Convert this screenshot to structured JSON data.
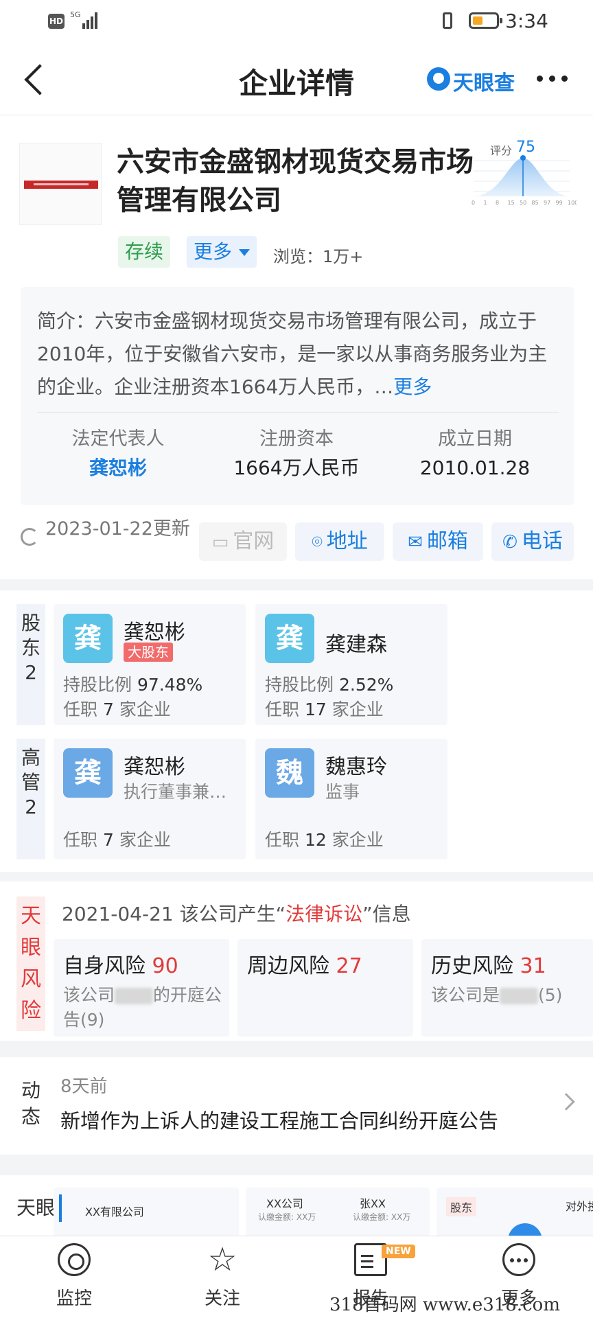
{
  "status": {
    "hd": "HD",
    "signal": "5G",
    "time": "3:34"
  },
  "header": {
    "title": "企业详情",
    "brand": "天眼查"
  },
  "company": {
    "name": "六安市金盛钢材现货交易市场管理有限公司",
    "score_label": "评分",
    "score": "75",
    "score_ticks": [
      "0",
      "1",
      "8",
      "15",
      "50",
      "85",
      "97",
      "99",
      "100"
    ],
    "tag_status": "存续",
    "tag_more": "更多",
    "views": "浏览：1万+",
    "intro_prefix": "简介：",
    "intro": "六安市金盛钢材现货交易市场管理有限公司，成立于2010年，位于安徽省六安市，是一家以从事商务服务业为主的企业。企业注册资本1664万人民币，…",
    "intro_more": "更多",
    "legal_rep_label": "法定代表人",
    "legal_rep": "龚恕彬",
    "capital_label": "注册资本",
    "capital": "1664万人民币",
    "founded_label": "成立日期",
    "founded": "2010.01.28",
    "updated": "2023-01-22更新",
    "actions": {
      "website": "官网",
      "address": "地址",
      "email": "邮箱",
      "phone": "电话"
    }
  },
  "shareholders": {
    "label": "股东2",
    "items": [
      {
        "avatar": "龚",
        "name": "龚恕彬",
        "badge": "大股东",
        "ratio_label": "持股比例",
        "ratio": "97.48%",
        "jobs_prefix": "任职",
        "jobs": "7",
        "jobs_suffix": "家企业"
      },
      {
        "avatar": "龚",
        "name": "龚建森",
        "ratio_label": "持股比例",
        "ratio": "2.52%",
        "jobs_prefix": "任职",
        "jobs": "17",
        "jobs_suffix": "家企业"
      }
    ]
  },
  "executives": {
    "label": "高管2",
    "items": [
      {
        "avatar": "龚",
        "name": "龚恕彬",
        "role": "执行董事兼…",
        "jobs_prefix": "任职",
        "jobs": "7",
        "jobs_suffix": "家企业"
      },
      {
        "avatar": "魏",
        "name": "魏惠玲",
        "role": "监事",
        "jobs_prefix": "任职",
        "jobs": "12",
        "jobs_suffix": "家企业"
      }
    ]
  },
  "risk": {
    "label": "天眼风险",
    "head_prefix": "2021-04-21 该公司产生“",
    "head_highlight": "法律诉讼",
    "head_suffix": "”信息",
    "cards": [
      {
        "title": "自身风险",
        "count": "90",
        "desc_prefix": "该公司",
        "desc_suffix": "的开庭公告(9)"
      },
      {
        "title": "周边风险",
        "count": "27",
        "desc_prefix": "",
        "desc_suffix": ""
      },
      {
        "title": "历史风险",
        "count": "31",
        "desc_prefix": "该公司是",
        "desc_suffix": "(5)"
      }
    ]
  },
  "dynamic": {
    "label": "动态",
    "ago": "8天前",
    "news": "新增作为上诉人的建设工程施工合同纠纷开庭公告"
  },
  "graphics": {
    "label": "天眼",
    "card1_title": "XX有限公司",
    "card2_a": "XX公司",
    "card2_a_sub": "认缴金额: XX万",
    "card2_b": "张XX",
    "card2_b_sub": "认缴金额: XX万",
    "card3_a": "股东",
    "card3_b": "对外投"
  },
  "tabs": [
    {
      "label": "监控"
    },
    {
      "label": "关注"
    },
    {
      "label": "报告",
      "badge": "NEW"
    },
    {
      "label": "更多"
    }
  ],
  "watermark": "318首码网 www.e318.com"
}
